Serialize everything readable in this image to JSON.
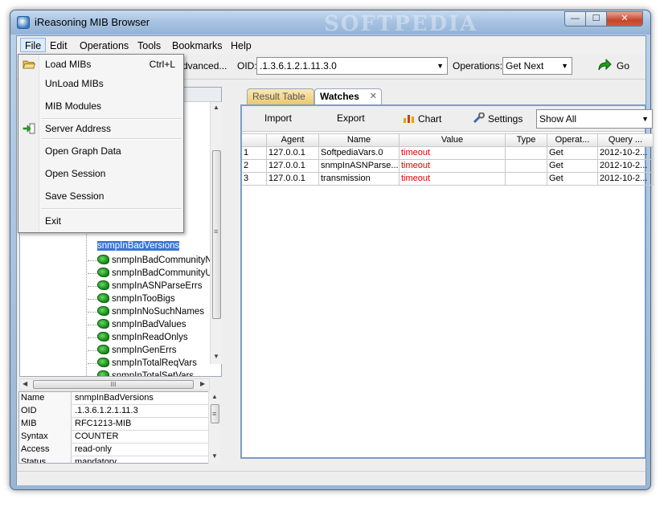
{
  "window": {
    "title": "iReasoning MIB Browser",
    "watermark": "SOFTPEDIA",
    "controls": {
      "minimize": "—",
      "maximize": "☐",
      "close": "✕"
    }
  },
  "menubar": [
    "File",
    "Edit",
    "Operations",
    "Tools",
    "Bookmarks",
    "Help"
  ],
  "toolbar": {
    "address_fragment": "dvanced...",
    "oid_label": "OID:",
    "oid_value": ".1.3.6.1.2.1.11.3.0",
    "operations_label": "Operations:",
    "operations_value": "Get Next",
    "go_label": "Go"
  },
  "file_menu": {
    "items": [
      {
        "label": "Load MIBs",
        "accelerator": "Ctrl+L",
        "icon": "folder-open-icon"
      },
      {
        "label": "UnLoad MIBs",
        "accelerator": ""
      },
      {
        "label": "MIB Modules",
        "accelerator": ""
      },
      {
        "label": "Server Address",
        "accelerator": "",
        "icon": "login-arrow-icon"
      },
      {
        "label": "Open Graph Data",
        "accelerator": ""
      },
      {
        "label": "Open Session",
        "accelerator": ""
      },
      {
        "label": "Save Session",
        "accelerator": ""
      },
      {
        "label": "Exit",
        "accelerator": ""
      }
    ]
  },
  "tree": {
    "selected_partial": "snmpInBadVersions",
    "nodes": [
      "snmpInBadCommunityNar",
      "snmpInBadCommunityUse",
      "snmpInASNParseErrs",
      "snmpInTooBigs",
      "snmpInNoSuchNames",
      "snmpInBadValues",
      "snmpInReadOnlys",
      "snmpInGenErrs",
      "snmpInTotalReqVars",
      "snmpInTotalSetVars"
    ]
  },
  "properties": [
    {
      "key": "Name",
      "value": "snmpInBadVersions"
    },
    {
      "key": "OID",
      "value": ".1.3.6.1.2.1.11.3"
    },
    {
      "key": "MIB",
      "value": "RFC1213-MIB"
    },
    {
      "key": "Syntax",
      "value": "COUNTER"
    },
    {
      "key": "Access",
      "value": "read-only"
    },
    {
      "key": "Status",
      "value": "mandatory"
    },
    {
      "key": "DefVal",
      "value": ""
    }
  ],
  "tabs": {
    "results": "Result Table",
    "watches": "Watches",
    "close": "✕"
  },
  "watches_toolbar": {
    "import": "Import",
    "export": "Export",
    "chart": "Chart",
    "settings": "Settings",
    "filter_value": "Show All"
  },
  "watches_table": {
    "columns": [
      "",
      "Agent",
      "Name",
      "Value",
      "Type",
      "Operat...",
      "Query ..."
    ],
    "rows": [
      [
        "1",
        "127.0.0.1",
        "SoftpediaVars.0",
        "timeout",
        "",
        "Get",
        "2012-10-2..."
      ],
      [
        "2",
        "127.0.0.1",
        "snmpInASNParse...",
        "timeout",
        "",
        "Get",
        "2012-10-2..."
      ],
      [
        "3",
        "127.0.0.1",
        "transmission",
        "timeout",
        "",
        "Get",
        "2012-10-2..."
      ]
    ]
  },
  "scroll_glyphs": {
    "up": "▲",
    "down": "▼",
    "left": "◀",
    "right": "▶",
    "grip": "≡",
    "hgrip": "III"
  },
  "colors": {
    "timeout": "#e00000",
    "selection": "#3875d7",
    "accent": "#7a9dc8"
  }
}
